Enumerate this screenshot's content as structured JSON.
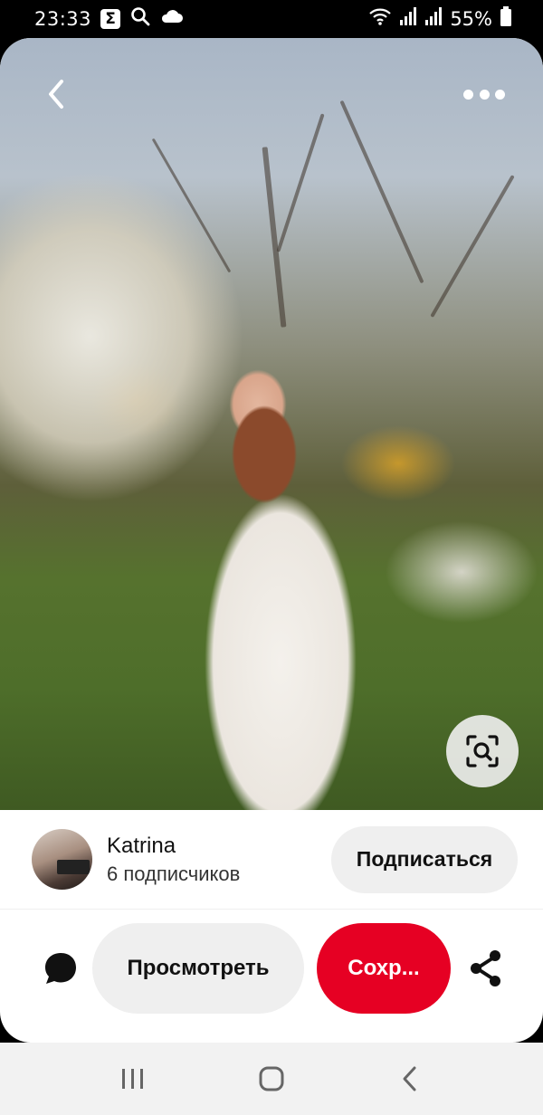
{
  "status_bar": {
    "time": "23:33",
    "battery": "55%",
    "icons": [
      "sigma-icon",
      "search-icon",
      "cloud-icon",
      "wifi-icon",
      "signal-icon",
      "signal-icon",
      "battery-icon"
    ]
  },
  "pin": {
    "image_icons": {
      "back": "chevron-left-icon",
      "more": "more-dots-icon",
      "visual_search": "visual-search-icon"
    }
  },
  "creator": {
    "name": "Katrina",
    "followers": "6 подписчиков",
    "follow_label": "Подписаться"
  },
  "actions": {
    "view_label": "Просмотреть",
    "save_label": "Сохр...",
    "comment_icon": "comment-icon",
    "share_icon": "share-icon"
  },
  "colors": {
    "save_red": "#e60023",
    "button_gray": "#efefef"
  },
  "nav_bar": {
    "icons": [
      "recent-apps-icon",
      "home-icon",
      "back-icon"
    ]
  }
}
